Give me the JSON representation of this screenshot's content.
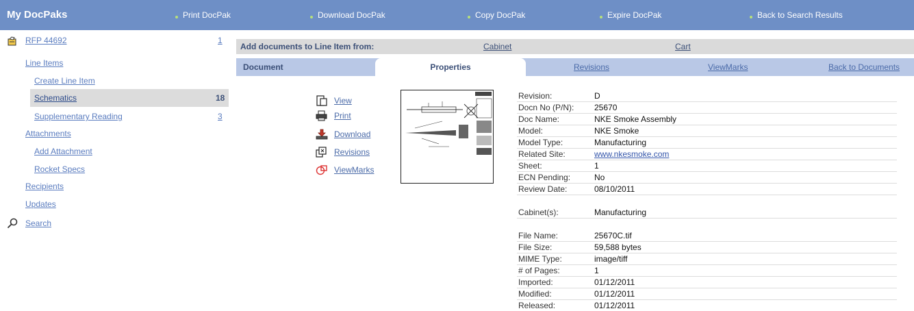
{
  "header": {
    "brand": "My DocPaks",
    "nav": [
      "Print DocPak",
      "Download DocPak",
      "Copy DocPak",
      "Expire DocPak",
      "Back to Search Results"
    ]
  },
  "sidebar": {
    "rfp": {
      "label": "RFP 44692",
      "count": "1"
    },
    "line_items": "Line Items",
    "create_line_item": "Create Line Item",
    "schematics": {
      "label": "Schematics",
      "count": "18"
    },
    "supplementary": {
      "label": "Supplementary Reading",
      "count": "3"
    },
    "attachments": "Attachments",
    "add_attachment": "Add Attachment",
    "rocket_specs": "Rocket Specs",
    "recipients": "Recipients",
    "updates": "Updates",
    "search": "Search"
  },
  "addbar": {
    "label": "Add documents to Line Item from:",
    "cabinet": "Cabinet",
    "cart": "Cart"
  },
  "tabs": {
    "document": "Document",
    "properties": "Properties",
    "revisions": "Revisions",
    "viewmarks": "ViewMarks",
    "back": "Back to Documents"
  },
  "actions": {
    "view": "View",
    "print": "Print",
    "download": "Download",
    "revisions": "Revisions",
    "viewmarks": "ViewMarks"
  },
  "properties": {
    "group1": [
      {
        "key": "Revision:",
        "value": "D"
      },
      {
        "key": "Docn No (P/N):",
        "value": "25670"
      },
      {
        "key": "Doc Name:",
        "value": "NKE Smoke Assembly"
      },
      {
        "key": "Model:",
        "value": "NKE Smoke"
      },
      {
        "key": "Model Type:",
        "value": "Manufacturing"
      },
      {
        "key": "Related Site:",
        "value": "www.nkesmoke.com"
      },
      {
        "key": "Sheet:",
        "value": "1"
      },
      {
        "key": "ECN Pending:",
        "value": "No"
      },
      {
        "key": "Review Date:",
        "value": "08/10/2011"
      }
    ],
    "cabinets": {
      "key": "Cabinet(s):",
      "value": "Manufacturing"
    },
    "group2": [
      {
        "key": "File Name:",
        "value": "25670C.tif"
      },
      {
        "key": "File Size:",
        "value": "59,588 bytes"
      },
      {
        "key": "MIME Type:",
        "value": "image/tiff"
      },
      {
        "key": "# of Pages:",
        "value": "1"
      },
      {
        "key": "Imported:",
        "value": "01/12/2011"
      },
      {
        "key": "Modified:",
        "value": "01/12/2011"
      },
      {
        "key": "Released:",
        "value": "01/12/2011"
      }
    ]
  },
  "colors": {
    "topbar": "#6e8fc6",
    "tabrow": "#b9c8e6",
    "link": "#5a7cbf",
    "selected": "#dcdcdc"
  }
}
